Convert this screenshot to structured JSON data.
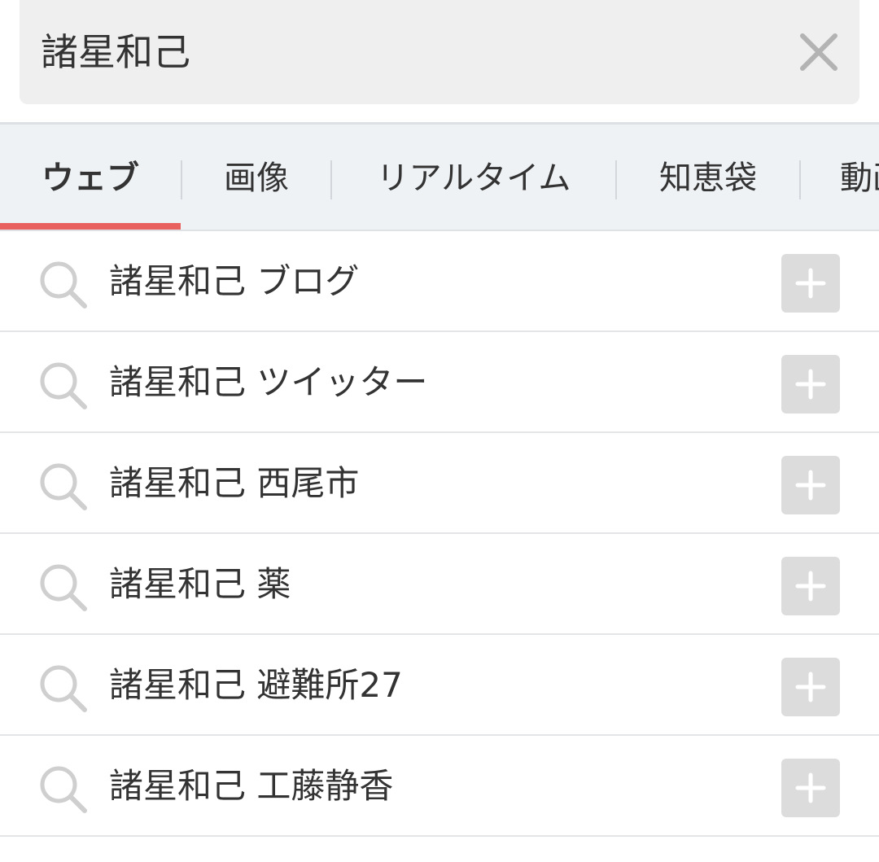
{
  "search": {
    "query": "諸星和己",
    "clear_icon": "close-icon"
  },
  "tabs": [
    {
      "label": "ウェブ",
      "active": true
    },
    {
      "label": "画像",
      "active": false
    },
    {
      "label": "リアルタイム",
      "active": false
    },
    {
      "label": "知恵袋",
      "active": false
    },
    {
      "label": "動画",
      "active": false
    }
  ],
  "suggestions": [
    {
      "text": "諸星和己 ブログ"
    },
    {
      "text": "諸星和己 ツイッター"
    },
    {
      "text": "諸星和己 西尾市"
    },
    {
      "text": "諸星和己 薬"
    },
    {
      "text": "諸星和己 避難所27"
    },
    {
      "text": "諸星和己 工藤静香"
    }
  ],
  "icons": {
    "suggestion_icon": "search-icon",
    "append_icon": "plus-icon"
  },
  "colors": {
    "active_tab_indicator": "#e8615f",
    "search_box_bg": "#efefef",
    "tab_bar_bg": "#eef2f5",
    "add_button_bg": "#dcdcdc"
  }
}
